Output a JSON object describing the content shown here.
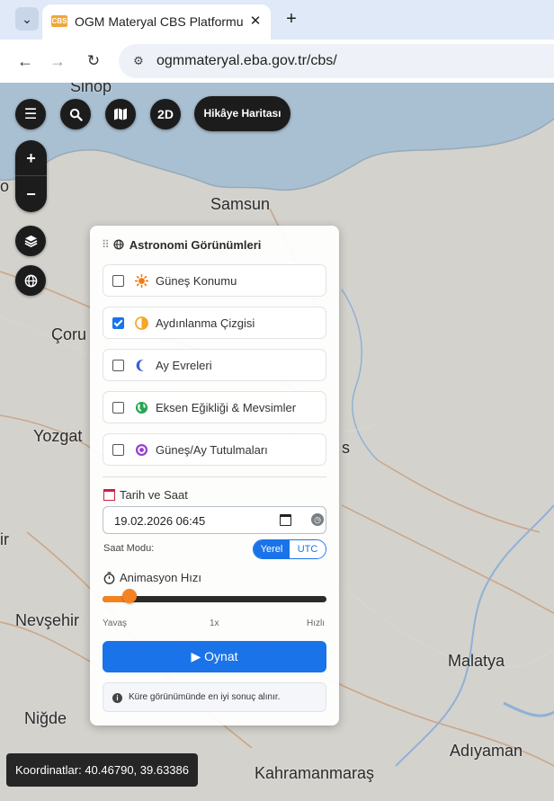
{
  "browser": {
    "tab_title": "OGM Materyal CBS Platformu",
    "favicon_text": "CBS",
    "close_glyph": "✕",
    "new_tab_glyph": "+",
    "url": "ogmmateryal.eba.gov.tr/cbs/",
    "icons": [
      "chevron-down-icon",
      "back-arrow-icon",
      "forward-arrow-icon",
      "reload-icon",
      "site-settings-icon"
    ]
  },
  "map": {
    "cities": [
      {
        "name": "Sinop"
      },
      {
        "name": "Samsun"
      },
      {
        "name": "Çoru"
      },
      {
        "name": "Yozgat"
      },
      {
        "name": "Nevşehir"
      },
      {
        "name": "Niğde"
      },
      {
        "name": "Malatya"
      },
      {
        "name": "Adıyaman"
      },
      {
        "name": "Kahramanmaraş"
      },
      {
        "name": "ir"
      },
      {
        "name": "s"
      },
      {
        "name": "o"
      }
    ],
    "colors": {
      "land": "#d4d2cd",
      "sea": "#a9c0d3",
      "road": "#c9a78a",
      "river": "#8fb1d6"
    }
  },
  "controls": {
    "menu_icon": "menu-icon",
    "search_icon": "search-icon",
    "map_icon": "map-icon",
    "view_2d_label": "2D",
    "story_map_label": "Hikâye Haritası",
    "zoom_in_label": "+",
    "zoom_out_label": "−",
    "layers_icon": "layers-icon",
    "globe_icon": "globe-icon"
  },
  "panel": {
    "title": "Astronomi Görünümleri",
    "options": [
      {
        "label": "Güneş Konumu",
        "checked": false,
        "icon": "sun-icon",
        "color": "#f07b16"
      },
      {
        "label": "Aydınlanma Çizgisi",
        "checked": true,
        "icon": "half-circle-icon",
        "color": "#f5a623"
      },
      {
        "label": "Ay Evreleri",
        "checked": false,
        "icon": "moon-icon",
        "color": "#3a5fd8"
      },
      {
        "label": "Eksen Eğikliği & Mevsimler",
        "checked": false,
        "icon": "earth-icon",
        "color": "#27a651"
      },
      {
        "label": "Güneş/Ay Tutulmaları",
        "checked": false,
        "icon": "eclipse-icon",
        "color": "#9b3fcf"
      }
    ],
    "datetime": {
      "label": "Tarih ve Saat",
      "value": "19.02.2026 06:45",
      "mode_label": "Saat Modu:",
      "mode_local": "Yerel",
      "mode_utc": "UTC",
      "selected_mode": "Yerel"
    },
    "animation": {
      "label": "Animasyon Hızı",
      "value_fraction": 0.12,
      "slow_label": "Yavaş",
      "speed_label": "1x",
      "fast_label": "Hızlı"
    },
    "play_label": "Oynat",
    "play_glyph": "▶",
    "info_text": "Küre görünümünde en iyi sonuç alınır."
  },
  "status": {
    "coordinates": "Koordinatlar: 40.46790, 39.63386"
  }
}
